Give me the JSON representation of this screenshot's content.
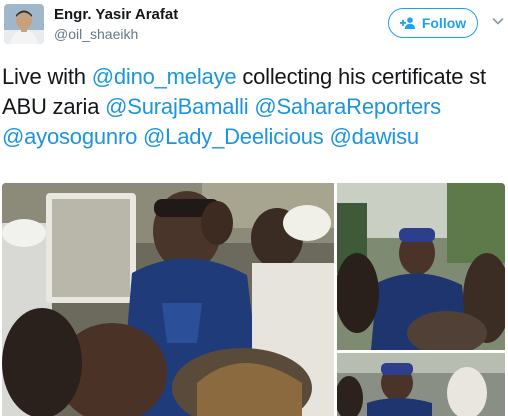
{
  "user": {
    "display_name": "Engr. Yasir Arafat",
    "handle": "@oil_shaeikh"
  },
  "actions": {
    "follow_label": "Follow",
    "follow_icon": "add-user-icon",
    "menu_icon": "chevron-down-icon"
  },
  "tweet": {
    "text_1": "Live with ",
    "mention_1": "@dino_melaye",
    "text_2": " collecting his certificate st ABU zaria ",
    "mention_2": "@SurajBamalli",
    "mention_3": "@SaharaReporters",
    "mention_4": "@ayosogunro",
    "mention_5": "@Lady_Deelicious",
    "mention_6": "@dawisu"
  },
  "colors": {
    "accent": "#1da1f2",
    "mention": "#1b95e0",
    "secondary_text": "#657786"
  }
}
